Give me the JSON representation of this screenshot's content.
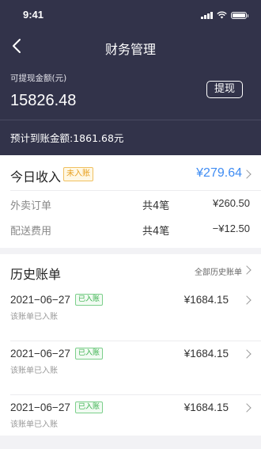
{
  "status_bar": {
    "time": "9:41"
  },
  "nav": {
    "title": "财务管理"
  },
  "balance": {
    "label": "可提现金额(元)",
    "amount": "15826.48",
    "withdraw_label": "提现",
    "expected_text": "预计到账金额:1861.68元"
  },
  "today": {
    "title": "今日收入",
    "badge": "未入账",
    "amount": "¥279.64",
    "rows": [
      {
        "label": "外卖订单",
        "count": "共4笔",
        "value": "¥260.50"
      },
      {
        "label": "配送费用",
        "count": "共4笔",
        "value": "−¥12.50"
      }
    ]
  },
  "history": {
    "title": "历史账单",
    "all_label": "全部历史账单",
    "bills": [
      {
        "date": "2021−06−27",
        "badge": "已入账",
        "amount": "¥1684.15",
        "status": "该账单已入账"
      },
      {
        "date": "2021−06−27",
        "badge": "已入账",
        "amount": "¥1684.15",
        "status": "该账单已入账"
      },
      {
        "date": "2021−06−27",
        "badge": "已入账",
        "amount": "¥1684.15",
        "status": "该账单已入账"
      }
    ]
  },
  "colors": {
    "header_bg": "#32334a",
    "accent_blue": "#3f8cf3",
    "badge_orange": "#e8a020",
    "badge_green": "#3bb24f"
  }
}
